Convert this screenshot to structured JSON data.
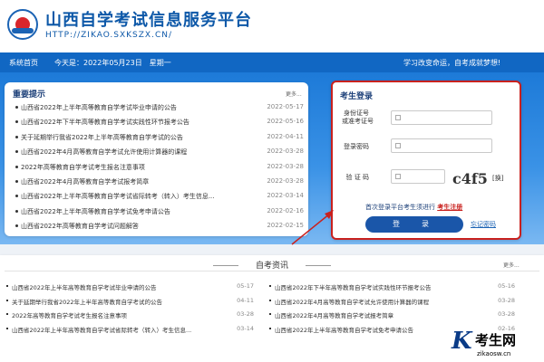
{
  "header": {
    "title": "山西自学考试信息服务平台",
    "url": "HTTP://ZIKAO.SXKSZX.CN/"
  },
  "navbar": {
    "home": "系统首页",
    "today": "今天是：2022年05月23日　星期一",
    "slogan": "学习改变命运，自考成就梦想!"
  },
  "notice": {
    "title": "重要提示",
    "more": "更多...",
    "items": [
      {
        "text": "山西省2022年上半年高等教育自学考试毕业申请的公告",
        "date": "2022-05-17"
      },
      {
        "text": "山西省2022年下半年高等教育自学考试实践性环节报考公告",
        "date": "2022-05-16"
      },
      {
        "text": "关于延期举行我省2022年上半年高等教育自学考试的公告",
        "date": "2022-04-11"
      },
      {
        "text": "山西省2022年4月高等教育自学考试允许使用计算器的课程",
        "date": "2022-03-28"
      },
      {
        "text": "2022年高等教育自学考试考生报名注意事项",
        "date": "2022-03-28"
      },
      {
        "text": "山西省2022年4月高等教育自学考试报考简章",
        "date": "2022-03-28"
      },
      {
        "text": "山西省2022年上半年高等教育自学考试省际转考（转入）考生信息...",
        "date": "2022-03-14"
      },
      {
        "text": "山西省2022年上半年高等教育自学考试免考申请公告",
        "date": "2022-02-16"
      },
      {
        "text": "山西省2022年高等教育自学考试问题解答",
        "date": "2022-02-15"
      }
    ]
  },
  "login": {
    "title": "考生登录",
    "id_label_1": "身份证号",
    "id_label_2": "或准考证号",
    "password_label": "登录密码",
    "captcha_label": "验 证 码",
    "captcha_value": "c4f5",
    "refresh": "[换]",
    "first_tip": "首次登录平台考生须进行",
    "register": "考生注册",
    "submit": "登　录",
    "forgot": "忘记密码"
  },
  "news": {
    "title": "自考资讯",
    "more": "更多...",
    "left": [
      {
        "text": "山西省2022年上半年高等教育自学考试毕业申请的公告",
        "date": "05-17"
      },
      {
        "text": "关于延期举行我省2022年上半年高等教育自学考试的公告",
        "date": "04-11"
      },
      {
        "text": "2022年高等教育自学考试考生报名注意事项",
        "date": "03-28"
      },
      {
        "text": "山西省2022年上半年高等教育自学考试省际转考（转入）考生信息...",
        "date": "03-14"
      }
    ],
    "right": [
      {
        "text": "山西省2022年下半年高等教育自学考试实践性环节报考公告",
        "date": "05-16"
      },
      {
        "text": "山西省2022年4月高等教育自学考试允许使用计算器的课程",
        "date": "03-28"
      },
      {
        "text": "山西省2022年4月高等教育自学考试报考简章",
        "date": "03-28"
      },
      {
        "text": "山西省2022年上半年高等教育自学考试免考申请公告",
        "date": "02-16"
      }
    ]
  },
  "watermark": {
    "brand": "考生网",
    "url": "zikaosw.cn"
  },
  "colors": {
    "primary": "#1167c3",
    "accent": "#c9211e"
  }
}
